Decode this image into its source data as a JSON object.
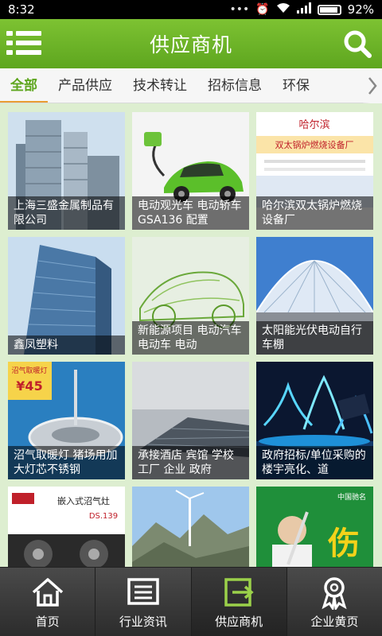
{
  "status_bar": {
    "time": "8:32",
    "battery_text": "92%",
    "battery_level": 0.92
  },
  "header": {
    "title": "供应商机"
  },
  "tabs": [
    {
      "label": "全部",
      "active": true
    },
    {
      "label": "产品供应",
      "active": false
    },
    {
      "label": "技术转让",
      "active": false
    },
    {
      "label": "招标信息",
      "active": false
    },
    {
      "label": "环保",
      "active": false
    }
  ],
  "grid": {
    "items": [
      {
        "caption": "上海三盛金属制品有限公司",
        "icon": "skyscraper-photo"
      },
      {
        "caption": "电动观光车 电动轿车 GSA136 配置",
        "icon": "electric-car-photo"
      },
      {
        "caption": "哈尔滨双太锅炉燃烧设备厂",
        "icon": "boiler-factory-photo",
        "image_text": [
          "哈尔滨",
          "双太锅炉燃烧设备厂"
        ]
      },
      {
        "caption": "鑫凤塑料",
        "icon": "office-building-photo"
      },
      {
        "caption": "新能源项目 电动汽车 电动车 电动",
        "icon": "wireframe-car-photo"
      },
      {
        "caption": "太阳能光伏电动自行车棚",
        "icon": "solar-canopy-photo"
      },
      {
        "caption": "沼气取暖灯 猪场用加大灯芯不锈钢",
        "icon": "heater-lamp-photo",
        "image_text": [
          "沼气取暖灯",
          "¥45"
        ]
      },
      {
        "caption": "承接酒店 宾馆 学校 工厂 企业 政府",
        "icon": "solar-roof-photo"
      },
      {
        "caption": "政府招标/单位采购的楼宇亮化、道",
        "icon": "fountain-night-photo"
      },
      {
        "caption": "",
        "icon": "gas-stove-photo",
        "image_text": [
          "嵌入式沼气灶",
          "DS.139"
        ]
      },
      {
        "caption": "",
        "icon": "wind-turbine-photo"
      },
      {
        "caption": "",
        "icon": "advertisement-photo",
        "image_text": [
          "伤",
          "中国驰名"
        ]
      }
    ]
  },
  "bottom_nav": [
    {
      "label": "首页",
      "icon": "home-icon",
      "active": false
    },
    {
      "label": "行业资讯",
      "icon": "news-icon",
      "active": false
    },
    {
      "label": "供应商机",
      "icon": "supply-icon",
      "active": true
    },
    {
      "label": "企业黄页",
      "icon": "award-icon",
      "active": false
    }
  ],
  "colors": {
    "accent": "#5ea61f",
    "tab_underline": "#e89d32",
    "nav_bg": "#3a3a3a"
  }
}
